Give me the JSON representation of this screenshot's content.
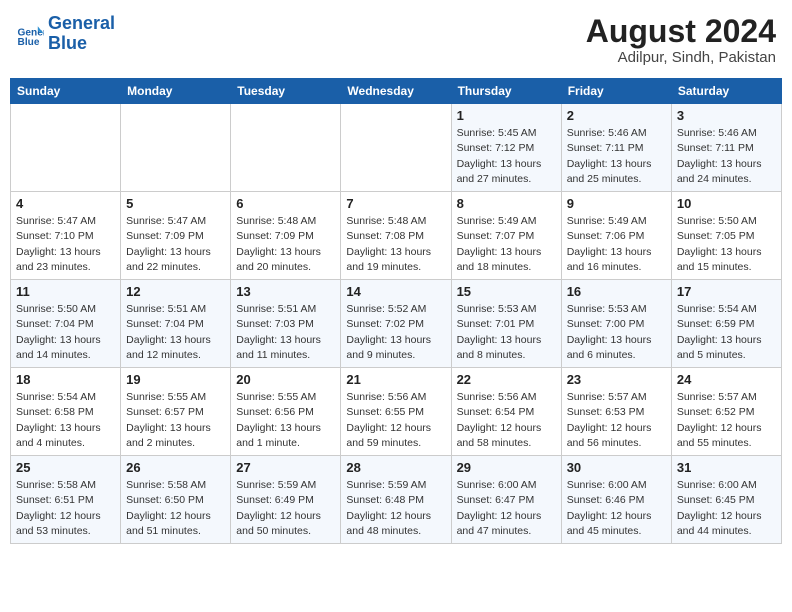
{
  "header": {
    "logo_line1": "General",
    "logo_line2": "Blue",
    "main_title": "August 2024",
    "subtitle": "Adilpur, Sindh, Pakistan"
  },
  "days_of_week": [
    "Sunday",
    "Monday",
    "Tuesday",
    "Wednesday",
    "Thursday",
    "Friday",
    "Saturday"
  ],
  "weeks": [
    [
      {
        "num": "",
        "info": ""
      },
      {
        "num": "",
        "info": ""
      },
      {
        "num": "",
        "info": ""
      },
      {
        "num": "",
        "info": ""
      },
      {
        "num": "1",
        "info": "Sunrise: 5:45 AM\nSunset: 7:12 PM\nDaylight: 13 hours\nand 27 minutes."
      },
      {
        "num": "2",
        "info": "Sunrise: 5:46 AM\nSunset: 7:11 PM\nDaylight: 13 hours\nand 25 minutes."
      },
      {
        "num": "3",
        "info": "Sunrise: 5:46 AM\nSunset: 7:11 PM\nDaylight: 13 hours\nand 24 minutes."
      }
    ],
    [
      {
        "num": "4",
        "info": "Sunrise: 5:47 AM\nSunset: 7:10 PM\nDaylight: 13 hours\nand 23 minutes."
      },
      {
        "num": "5",
        "info": "Sunrise: 5:47 AM\nSunset: 7:09 PM\nDaylight: 13 hours\nand 22 minutes."
      },
      {
        "num": "6",
        "info": "Sunrise: 5:48 AM\nSunset: 7:09 PM\nDaylight: 13 hours\nand 20 minutes."
      },
      {
        "num": "7",
        "info": "Sunrise: 5:48 AM\nSunset: 7:08 PM\nDaylight: 13 hours\nand 19 minutes."
      },
      {
        "num": "8",
        "info": "Sunrise: 5:49 AM\nSunset: 7:07 PM\nDaylight: 13 hours\nand 18 minutes."
      },
      {
        "num": "9",
        "info": "Sunrise: 5:49 AM\nSunset: 7:06 PM\nDaylight: 13 hours\nand 16 minutes."
      },
      {
        "num": "10",
        "info": "Sunrise: 5:50 AM\nSunset: 7:05 PM\nDaylight: 13 hours\nand 15 minutes."
      }
    ],
    [
      {
        "num": "11",
        "info": "Sunrise: 5:50 AM\nSunset: 7:04 PM\nDaylight: 13 hours\nand 14 minutes."
      },
      {
        "num": "12",
        "info": "Sunrise: 5:51 AM\nSunset: 7:04 PM\nDaylight: 13 hours\nand 12 minutes."
      },
      {
        "num": "13",
        "info": "Sunrise: 5:51 AM\nSunset: 7:03 PM\nDaylight: 13 hours\nand 11 minutes."
      },
      {
        "num": "14",
        "info": "Sunrise: 5:52 AM\nSunset: 7:02 PM\nDaylight: 13 hours\nand 9 minutes."
      },
      {
        "num": "15",
        "info": "Sunrise: 5:53 AM\nSunset: 7:01 PM\nDaylight: 13 hours\nand 8 minutes."
      },
      {
        "num": "16",
        "info": "Sunrise: 5:53 AM\nSunset: 7:00 PM\nDaylight: 13 hours\nand 6 minutes."
      },
      {
        "num": "17",
        "info": "Sunrise: 5:54 AM\nSunset: 6:59 PM\nDaylight: 13 hours\nand 5 minutes."
      }
    ],
    [
      {
        "num": "18",
        "info": "Sunrise: 5:54 AM\nSunset: 6:58 PM\nDaylight: 13 hours\nand 4 minutes."
      },
      {
        "num": "19",
        "info": "Sunrise: 5:55 AM\nSunset: 6:57 PM\nDaylight: 13 hours\nand 2 minutes."
      },
      {
        "num": "20",
        "info": "Sunrise: 5:55 AM\nSunset: 6:56 PM\nDaylight: 13 hours\nand 1 minute."
      },
      {
        "num": "21",
        "info": "Sunrise: 5:56 AM\nSunset: 6:55 PM\nDaylight: 12 hours\nand 59 minutes."
      },
      {
        "num": "22",
        "info": "Sunrise: 5:56 AM\nSunset: 6:54 PM\nDaylight: 12 hours\nand 58 minutes."
      },
      {
        "num": "23",
        "info": "Sunrise: 5:57 AM\nSunset: 6:53 PM\nDaylight: 12 hours\nand 56 minutes."
      },
      {
        "num": "24",
        "info": "Sunrise: 5:57 AM\nSunset: 6:52 PM\nDaylight: 12 hours\nand 55 minutes."
      }
    ],
    [
      {
        "num": "25",
        "info": "Sunrise: 5:58 AM\nSunset: 6:51 PM\nDaylight: 12 hours\nand 53 minutes."
      },
      {
        "num": "26",
        "info": "Sunrise: 5:58 AM\nSunset: 6:50 PM\nDaylight: 12 hours\nand 51 minutes."
      },
      {
        "num": "27",
        "info": "Sunrise: 5:59 AM\nSunset: 6:49 PM\nDaylight: 12 hours\nand 50 minutes."
      },
      {
        "num": "28",
        "info": "Sunrise: 5:59 AM\nSunset: 6:48 PM\nDaylight: 12 hours\nand 48 minutes."
      },
      {
        "num": "29",
        "info": "Sunrise: 6:00 AM\nSunset: 6:47 PM\nDaylight: 12 hours\nand 47 minutes."
      },
      {
        "num": "30",
        "info": "Sunrise: 6:00 AM\nSunset: 6:46 PM\nDaylight: 12 hours\nand 45 minutes."
      },
      {
        "num": "31",
        "info": "Sunrise: 6:00 AM\nSunset: 6:45 PM\nDaylight: 12 hours\nand 44 minutes."
      }
    ]
  ]
}
